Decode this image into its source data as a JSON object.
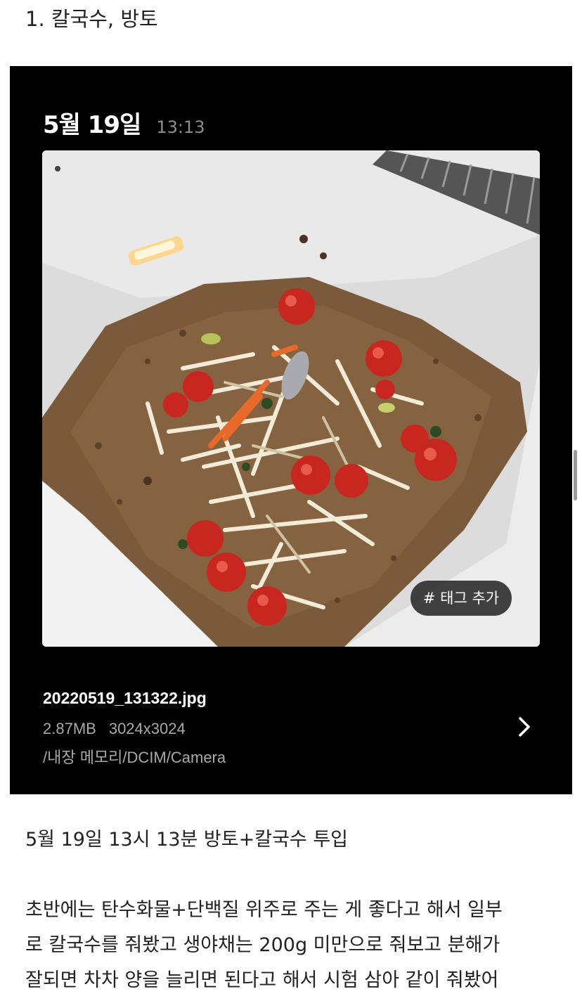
{
  "post": {
    "heading": "1. 칼국수, 방토",
    "caption": "5월 19일 13시 13분 방토+칼국수 투입",
    "body_lines": [
      "초반에는 탄수화물+단백질 위주로 주는 게 좋다고 해서 일부",
      "로 칼국수를 줘봤고 생야채는 200g 미만으로 줘보고 분해가",
      "잘되면 차차 양을 늘리면 된다고 해서 시험 삼아 같이 줘봤어"
    ]
  },
  "gallery": {
    "date": "5월 19일",
    "time": "13:13",
    "tag_button": "# 태그 추가",
    "file_name": "20220519_131322.jpg",
    "file_size": "2.87MB",
    "resolution": "3024x3024",
    "path": "/내장 메모리/DCIM/Camera",
    "detail_icon": "chevron-right-icon"
  },
  "colors": {
    "card_background": "#000000",
    "meta_text": "#a8a8a8",
    "soil": "#7a5a3a",
    "tomato": "#c8271f",
    "carrot": "#e86a2a"
  }
}
